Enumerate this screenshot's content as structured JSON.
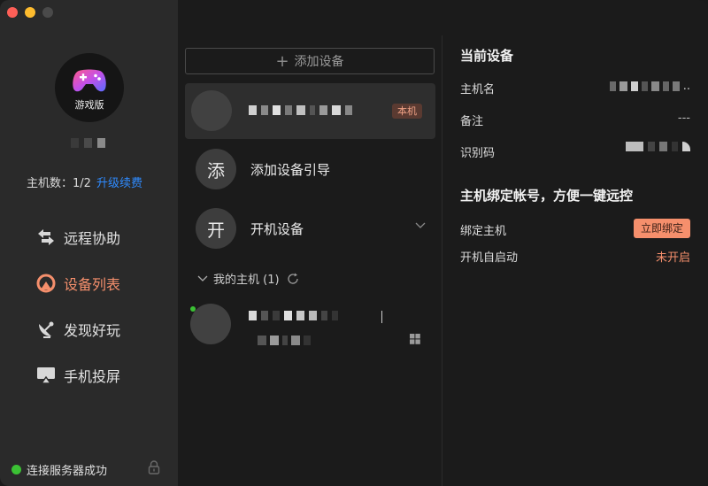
{
  "sidebar": {
    "avatar_caption": "游戏版",
    "hosts_label": "主机数：1/2",
    "upgrade_link": "升级续费",
    "nav": [
      {
        "label": "远程协助"
      },
      {
        "label": "设备列表"
      },
      {
        "label": "发现好玩"
      },
      {
        "label": "手机投屏"
      }
    ],
    "status_text": "连接服务器成功"
  },
  "middle": {
    "add_device_label": "添加设备",
    "local_badge": "本机",
    "guide": {
      "icon_char": "添",
      "label": "添加设备引导"
    },
    "boot": {
      "icon_char": "开",
      "label": "开机设备"
    },
    "my_hosts_label": "我的主机 (1)"
  },
  "right": {
    "current_title": "当前设备",
    "hostname_label": "主机名",
    "hostname_trail": "..",
    "note_label": "备注",
    "note_value": "---",
    "id_label": "识别码",
    "bind_title": "主机绑定帐号，方便一键远控",
    "bind_host_label": "绑定主机",
    "bind_button": "立即绑定",
    "autostart_label": "开机自启动",
    "autostart_value": "未开启"
  },
  "colors": {
    "accent_orange": "#f58f6c",
    "link_blue": "#2f8bff",
    "online_green": "#3bc134"
  }
}
